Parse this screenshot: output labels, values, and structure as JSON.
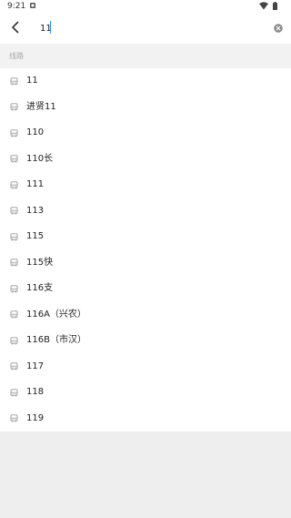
{
  "status_bar": {
    "time": "9:21"
  },
  "search": {
    "value": "11"
  },
  "section": {
    "label": "线路"
  },
  "results": [
    "11",
    "进贤11",
    "110",
    "110长",
    "111",
    "113",
    "115",
    "115快",
    "116支",
    "116A（兴农）",
    "116B（市汉）",
    "117",
    "118",
    "119"
  ],
  "icons": {
    "back": "back-arrow-icon",
    "clear": "clear-icon",
    "result": "bus-icon",
    "status_app": "app-notification-icon",
    "status_wifi": "wifi-icon",
    "status_battery": "battery-icon"
  },
  "colors": {
    "accent": "#2b8af2",
    "section_background": "#f2f2f2",
    "empty_background": "#eeeeee",
    "icon_gray": "#9a9a9a"
  }
}
